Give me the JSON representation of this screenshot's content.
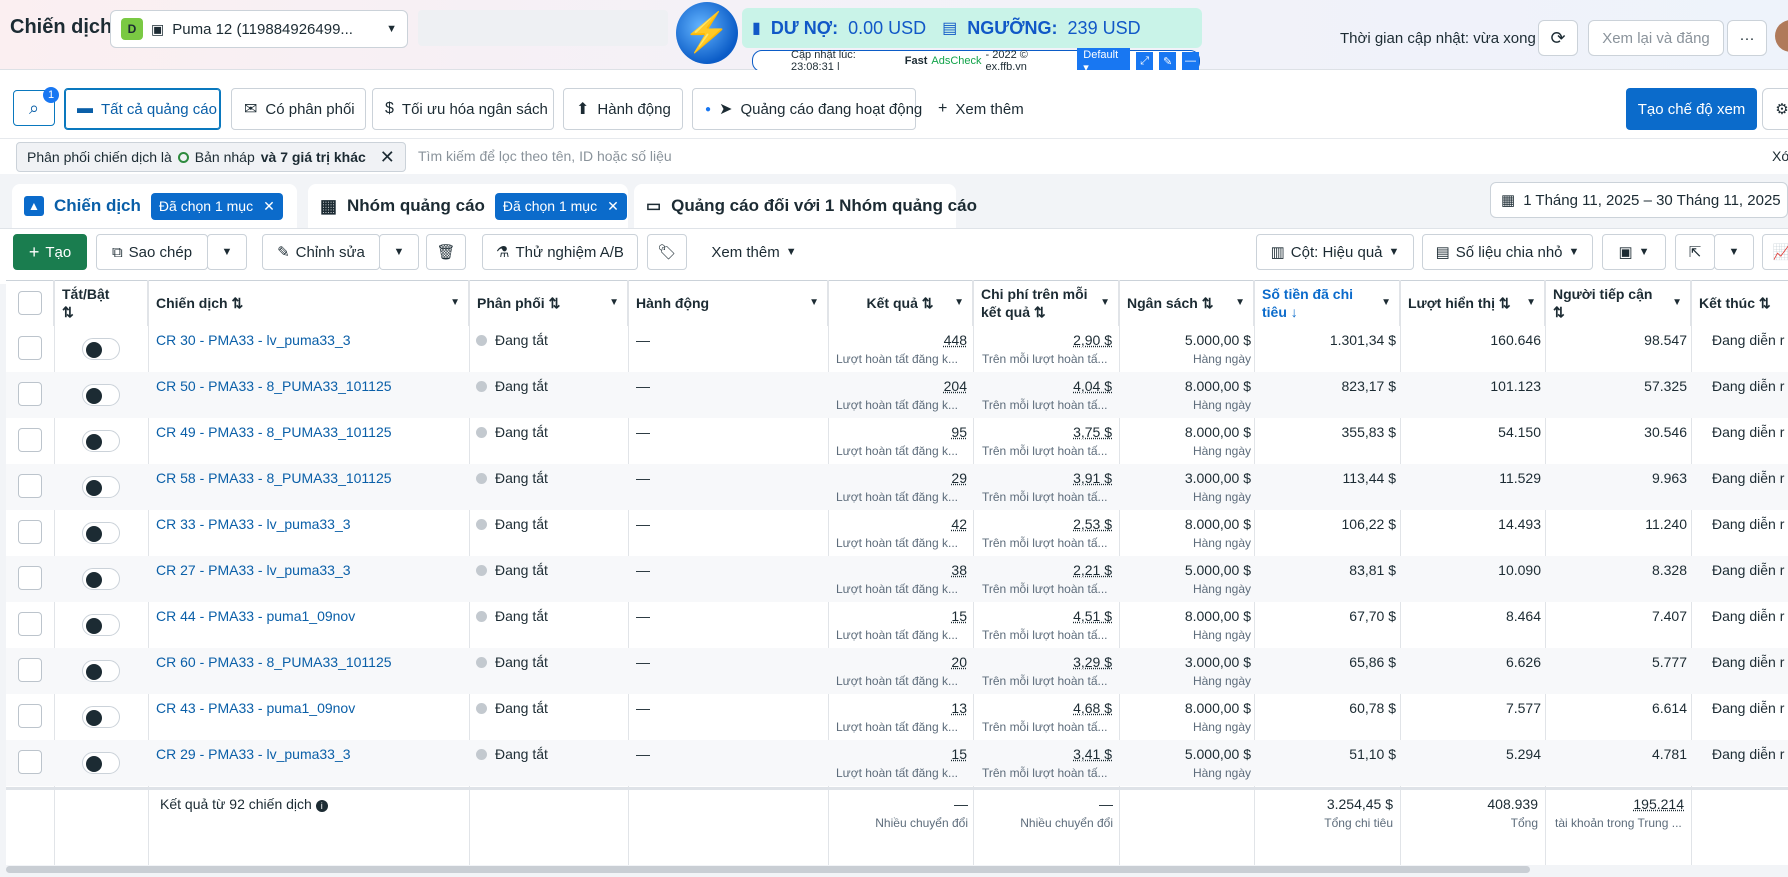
{
  "header": {
    "title": "Chiến dịch",
    "account_badge": "D",
    "account_name": "Puma 12 (119884926499...",
    "update_text": "Thời gian cập nhật: vừa xong",
    "review_publish": "Xem lại và đăng",
    "more": "···"
  },
  "extension": {
    "debt_label": "DƯ NỢ:",
    "debt_value": "0.00 USD",
    "threshold_label": "NGƯỠNG:",
    "threshold_value": "239 USD",
    "updated": "Cập nhật lúc: 23:08:31 |",
    "fast": "Fast",
    "adscheck": "AdsCheck",
    "credit": "- 2022 © ex.ffb.vn",
    "preset": "Default"
  },
  "tabs": {
    "search_badge": "1",
    "all_ads": "Tất cả quảng cáo",
    "delivered": "Có phân phối",
    "budget_opt": "Tối ưu hóa ngân sách",
    "actions": "Hành động",
    "active_ads": "Quảng cáo đang hoạt động",
    "see_more": "Xem thêm",
    "create_view": "Tạo chế độ xem"
  },
  "filter": {
    "prefix": "Phân phối chiến dịch là",
    "draft": "Bản nháp",
    "more": "và 7 giá trị khác",
    "placeholder": "Tìm kiếm để lọc theo tên, ID hoặc số liệu",
    "clear": "Xóa"
  },
  "levels": {
    "campaign": "Chiến dịch",
    "campaign_sel": "Đã chọn 1 mục",
    "adset": "Nhóm quảng cáo",
    "adset_sel": "Đã chọn 1 mục",
    "ads": "Quảng cáo đối với 1 Nhóm quảng cáo",
    "date_range": "1 Tháng 11, 2025 – 30 Tháng 11, 2025"
  },
  "toolbar": {
    "create": "Tạo",
    "duplicate": "Sao chép",
    "edit": "Chỉnh sửa",
    "ab_test": "Thử nghiệm A/B",
    "see_more": "Xem thêm",
    "columns": "Cột: Hiệu quả",
    "breakdown": "Số liệu chia nhỏ"
  },
  "columns": {
    "toggle": "Tắt/Bật",
    "campaign": "Chiến dịch",
    "delivery": "Phân phối",
    "actions": "Hành động",
    "results": "Kết quả",
    "cpr": "Chi phí trên mỗi kết quả",
    "budget": "Ngân sách",
    "spent": "Số tiền đã chi tiêu",
    "impressions": "Lượt hiển thị",
    "reach": "Người tiếp cận",
    "ends": "Kết thúc"
  },
  "rows": [
    {
      "name": "CR 30 - PMA33 - lv_puma33_3",
      "delivery": "Đang tắt",
      "action": "—",
      "result": "448",
      "result_sub": "Lượt hoàn tất đăng k...",
      "cpr": "2,90 $",
      "cpr_sub": "Trên mỗi lượt hoàn tấ...",
      "budget": "5.000,00 $",
      "budget_sub": "Hàng ngày",
      "spent": "1.301,34 $",
      "impr": "160.646",
      "reach": "98.547",
      "ends": "Đang diễn r"
    },
    {
      "name": "CR 50 - PMA33 - 8_PUMA33_101125",
      "delivery": "Đang tắt",
      "action": "—",
      "result": "204",
      "result_sub": "Lượt hoàn tất đăng k...",
      "cpr": "4,04 $",
      "cpr_sub": "Trên mỗi lượt hoàn tấ...",
      "budget": "8.000,00 $",
      "budget_sub": "Hàng ngày",
      "spent": "823,17 $",
      "impr": "101.123",
      "reach": "57.325",
      "ends": "Đang diễn r"
    },
    {
      "name": "CR 49 - PMA33 - 8_PUMA33_101125",
      "delivery": "Đang tắt",
      "action": "—",
      "result": "95",
      "result_sub": "Lượt hoàn tất đăng k...",
      "cpr": "3,75 $",
      "cpr_sub": "Trên mỗi lượt hoàn tấ...",
      "budget": "8.000,00 $",
      "budget_sub": "Hàng ngày",
      "spent": "355,83 $",
      "impr": "54.150",
      "reach": "30.546",
      "ends": "Đang diễn r"
    },
    {
      "name": "CR 58 - PMA33 - 8_PUMA33_101125",
      "delivery": "Đang tắt",
      "action": "—",
      "result": "29",
      "result_sub": "Lượt hoàn tất đăng k...",
      "cpr": "3,91 $",
      "cpr_sub": "Trên mỗi lượt hoàn tấ...",
      "budget": "3.000,00 $",
      "budget_sub": "Hàng ngày",
      "spent": "113,44 $",
      "impr": "11.529",
      "reach": "9.963",
      "ends": "Đang diễn r"
    },
    {
      "name": "CR 33 - PMA33 - lv_puma33_3",
      "delivery": "Đang tắt",
      "action": "—",
      "result": "42",
      "result_sub": "Lượt hoàn tất đăng k...",
      "cpr": "2,53 $",
      "cpr_sub": "Trên mỗi lượt hoàn tấ...",
      "budget": "8.000,00 $",
      "budget_sub": "Hàng ngày",
      "spent": "106,22 $",
      "impr": "14.493",
      "reach": "11.240",
      "ends": "Đang diễn r"
    },
    {
      "name": "CR 27 - PMA33 - lv_puma33_3",
      "delivery": "Đang tắt",
      "action": "—",
      "result": "38",
      "result_sub": "Lượt hoàn tất đăng k...",
      "cpr": "2,21 $",
      "cpr_sub": "Trên mỗi lượt hoàn tấ...",
      "budget": "5.000,00 $",
      "budget_sub": "Hàng ngày",
      "spent": "83,81 $",
      "impr": "10.090",
      "reach": "8.328",
      "ends": "Đang diễn r"
    },
    {
      "name": "CR 44 - PMA33 - puma1_09nov",
      "delivery": "Đang tắt",
      "action": "—",
      "result": "15",
      "result_sub": "Lượt hoàn tất đăng k...",
      "cpr": "4,51 $",
      "cpr_sub": "Trên mỗi lượt hoàn tấ...",
      "budget": "8.000,00 $",
      "budget_sub": "Hàng ngày",
      "spent": "67,70 $",
      "impr": "8.464",
      "reach": "7.407",
      "ends": "Đang diễn r"
    },
    {
      "name": "CR 60 - PMA33 - 8_PUMA33_101125",
      "delivery": "Đang tắt",
      "action": "—",
      "result": "20",
      "result_sub": "Lượt hoàn tất đăng k...",
      "cpr": "3,29 $",
      "cpr_sub": "Trên mỗi lượt hoàn tấ...",
      "budget": "3.000,00 $",
      "budget_sub": "Hàng ngày",
      "spent": "65,86 $",
      "impr": "6.626",
      "reach": "5.777",
      "ends": "Đang diễn r"
    },
    {
      "name": "CR 43 - PMA33 - puma1_09nov",
      "delivery": "Đang tắt",
      "action": "—",
      "result": "13",
      "result_sub": "Lượt hoàn tất đăng k...",
      "cpr": "4,68 $",
      "cpr_sub": "Trên mỗi lượt hoàn tấ...",
      "budget": "8.000,00 $",
      "budget_sub": "Hàng ngày",
      "spent": "60,78 $",
      "impr": "7.577",
      "reach": "6.614",
      "ends": "Đang diễn r"
    },
    {
      "name": "CR 29 - PMA33 - lv_puma33_3",
      "delivery": "Đang tắt",
      "action": "—",
      "result": "15",
      "result_sub": "Lượt hoàn tất đăng k...",
      "cpr": "3,41 $",
      "cpr_sub": "Trên mỗi lượt hoàn tấ...",
      "budget": "5.000,00 $",
      "budget_sub": "Hàng ngày",
      "spent": "51,10 $",
      "impr": "5.294",
      "reach": "4.781",
      "ends": "Đang diễn r"
    }
  ],
  "totals": {
    "label": "Kết quả từ 92 chiến dịch",
    "result": "—",
    "result_sub": "Nhiều chuyển đổi",
    "cpr": "—",
    "cpr_sub": "Nhiều chuyển đổi",
    "spent": "3.254,45 $",
    "spent_sub": "Tổng chi tiêu",
    "impr": "408.939",
    "impr_sub": "Tổng",
    "reach": "195.214",
    "reach_sub": "tài khoản trong Trung ..."
  }
}
